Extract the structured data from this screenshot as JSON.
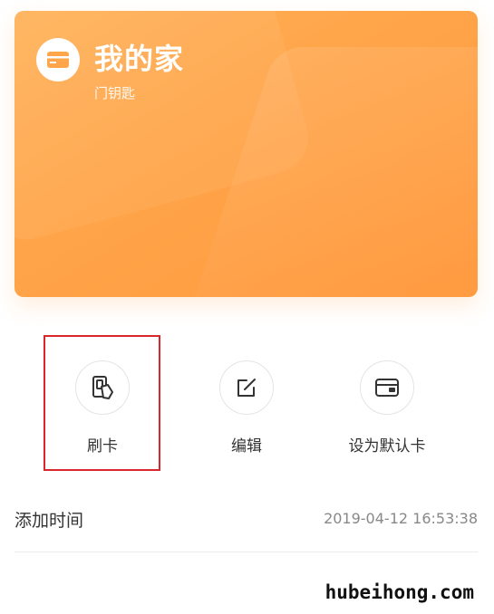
{
  "card": {
    "title": "我的家",
    "subtitle": "门钥匙",
    "icon": "card-icon",
    "color": "#ffa54a"
  },
  "actions": [
    {
      "label": "刷卡",
      "icon": "swipe-card-icon"
    },
    {
      "label": "编辑",
      "icon": "edit-icon"
    },
    {
      "label": "设为默认卡",
      "icon": "default-card-icon"
    }
  ],
  "info": {
    "label": "添加时间",
    "value": "2019-04-12 16:53:38"
  },
  "watermark": "hubeihong.com",
  "highlight_color": "#d9262b"
}
